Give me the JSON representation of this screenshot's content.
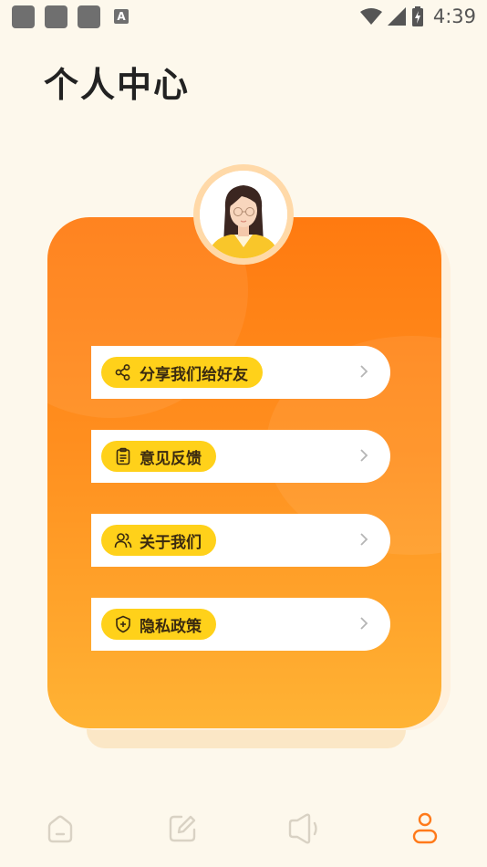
{
  "status_bar": {
    "time": "4:39",
    "notification_badge": "A",
    "icons": [
      "notification-icon",
      "notification-icon",
      "notification-icon",
      "wifi-icon",
      "signal-icon",
      "battery-charging-icon"
    ]
  },
  "page": {
    "title": "个人中心"
  },
  "menu": [
    {
      "label": "分享我们给好友",
      "icon": "share-icon"
    },
    {
      "label": "意见反馈",
      "icon": "clipboard-icon"
    },
    {
      "label": "关于我们",
      "icon": "users-icon"
    },
    {
      "label": "隐私政策",
      "icon": "shield-icon"
    }
  ],
  "tabbar": {
    "tabs": [
      {
        "icon": "home-icon",
        "active": false
      },
      {
        "icon": "edit-icon",
        "active": false
      },
      {
        "icon": "speaker-icon",
        "active": false
      },
      {
        "icon": "profile-icon",
        "active": true
      }
    ]
  },
  "colors": {
    "background": "#fdf8ec",
    "card_top": "#ff7a10",
    "card_bottom": "#ffb334",
    "pill": "#ffd11a",
    "tab_active": "#ff7a1a",
    "tab_inactive": "#d9d2c4"
  }
}
